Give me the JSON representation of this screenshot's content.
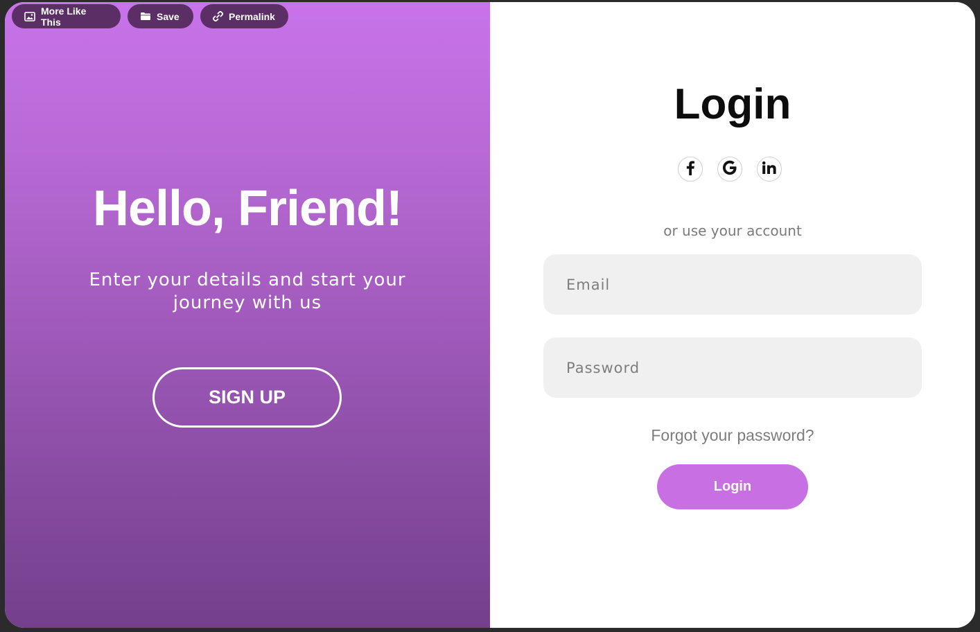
{
  "toolbar": {
    "more_like_this": "More Like This",
    "save": "Save",
    "permalink": "Permalink"
  },
  "welcome": {
    "title": "Hello, Friend!",
    "subtitle": "Enter your details and start your journey with us",
    "signup_label": "SIGN UP"
  },
  "login": {
    "title": "Login",
    "social": [
      {
        "name": "facebook-icon",
        "glyph": "f"
      },
      {
        "name": "google-icon",
        "glyph": "G"
      },
      {
        "name": "linkedin-icon",
        "glyph": "in"
      }
    ],
    "divider_text": "or use your account",
    "email_placeholder": "Email",
    "password_placeholder": "Password",
    "forgot_label": "Forgot your password?",
    "submit_label": "Login"
  },
  "colors": {
    "gradient_top": "#c873ea",
    "gradient_bottom": "#743f8c",
    "accent": "#c86fe4",
    "pill_bg": "#5b2f66",
    "field_bg": "#f0f0f0"
  }
}
